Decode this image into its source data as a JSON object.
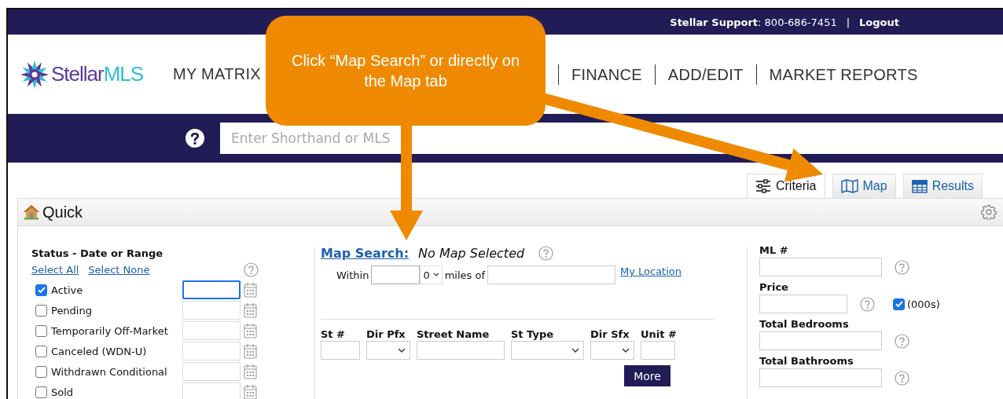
{
  "top_bar": {
    "support_label": "Stellar Support",
    "support_phone": ": 800-686-7451",
    "separator": "|",
    "logout": "Logout"
  },
  "logo": {
    "part_1": "Stellar",
    "part_2": "MLS"
  },
  "nav_left": [
    "MY MATRIX"
  ],
  "nav_right": [
    "FINANCE",
    "ADD/EDIT",
    "MARKET REPORTS"
  ],
  "search": {
    "placeholder": "Enter Shorthand or MLS"
  },
  "view_tabs": [
    {
      "label": "Criteria",
      "selected": true
    },
    {
      "label": "Map",
      "selected": false
    },
    {
      "label": "Results",
      "selected": false
    }
  ],
  "panel": {
    "title": "Quick"
  },
  "status": {
    "title": "Status - Date or Range",
    "links": [
      "Select All",
      "Select None"
    ],
    "items": [
      {
        "label": "Active",
        "checked": true,
        "focused": true
      },
      {
        "label": "Pending",
        "checked": false,
        "focused": false
      },
      {
        "label": "Temporarily Off-Market",
        "checked": false,
        "focused": false
      },
      {
        "label": "Canceled (WDN-U)",
        "checked": false,
        "focused": false
      },
      {
        "label": "Withdrawn Conditional",
        "checked": false,
        "focused": false
      },
      {
        "label": "Sold",
        "checked": false,
        "focused": false
      }
    ]
  },
  "map_search": {
    "link": "Map Search:",
    "status": "No Map Selected",
    "within_label": "Within",
    "miles_value": "0",
    "miles_label": "miles of",
    "location_link": "My Location"
  },
  "address": {
    "fields": [
      {
        "label": "St #",
        "kind": "text"
      },
      {
        "label": "Dir Pfx",
        "kind": "select"
      },
      {
        "label": "Street Name",
        "kind": "text"
      },
      {
        "label": "St Type",
        "kind": "select"
      },
      {
        "label": "Dir Sfx",
        "kind": "select"
      },
      {
        "label": "Unit #",
        "kind": "text"
      }
    ],
    "more_button": "More"
  },
  "right_fields": [
    {
      "label": "ML #",
      "kind": "wide"
    },
    {
      "label": "Price",
      "kind": "short",
      "unit": {
        "label": "(000s)",
        "checked": true
      }
    },
    {
      "label": "Total Bedrooms",
      "kind": "wide"
    },
    {
      "label": "Total Bathrooms",
      "kind": "wide"
    }
  ],
  "callout": {
    "text": "Click “Map Search” or directly on the Map tab"
  }
}
